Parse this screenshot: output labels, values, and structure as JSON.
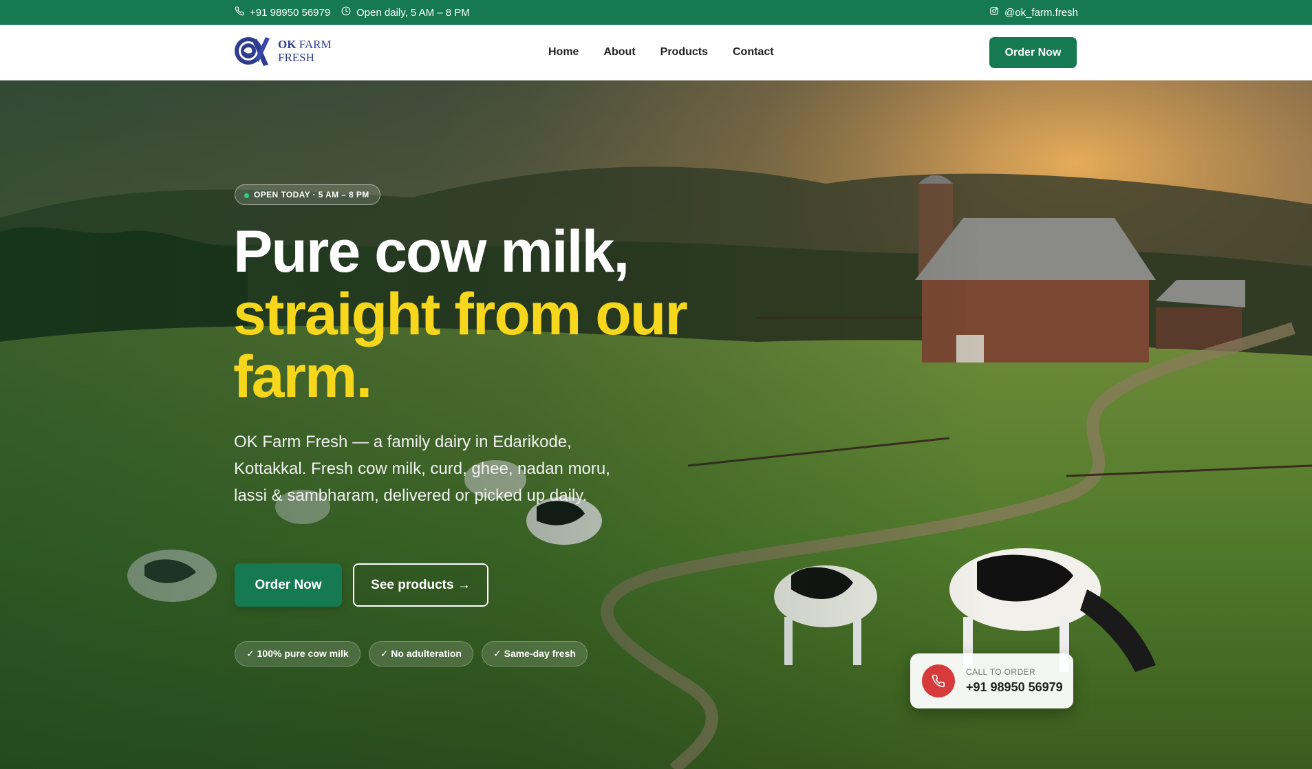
{
  "topbar": {
    "phone": "+91 98950 56979",
    "hours": "Open daily, 5 AM – 8 PM",
    "instagram": "@ok_farm.fresh"
  },
  "brand": {
    "name_bold": "OK",
    "name_rest": " FARM",
    "name_line2": "FRESH"
  },
  "nav": {
    "links": [
      "Home",
      "About",
      "Products",
      "Contact"
    ],
    "cta": "Order Now"
  },
  "hero": {
    "open_pill": "OPEN TODAY · 5 AM – 8 PM",
    "headline_part1": "Pure cow milk, ",
    "headline_part2": "straight from our farm.",
    "lead": "OK Farm Fresh — a family dairy in Edarikode, Kottakkal. Fresh cow milk, curd, ghee, nadan moru, lassi & sambharam, delivered or picked up daily.",
    "primary_cta": "Order Now",
    "secondary_cta": "See products →",
    "badges": [
      "✓ 100% pure cow milk",
      "✓ No adulteration",
      "✓ Same-day fresh"
    ]
  },
  "call_card": {
    "label": "CALL TO ORDER",
    "number": "+91 98950 56979"
  },
  "colors": {
    "brand_green": "#157a52",
    "accent_yellow": "#f7d71c",
    "call_red": "#d63a3a",
    "logo_blue": "#2f3c8f"
  },
  "icons": [
    "phone-icon",
    "clock-icon",
    "instagram-icon",
    "phone-call-icon"
  ]
}
